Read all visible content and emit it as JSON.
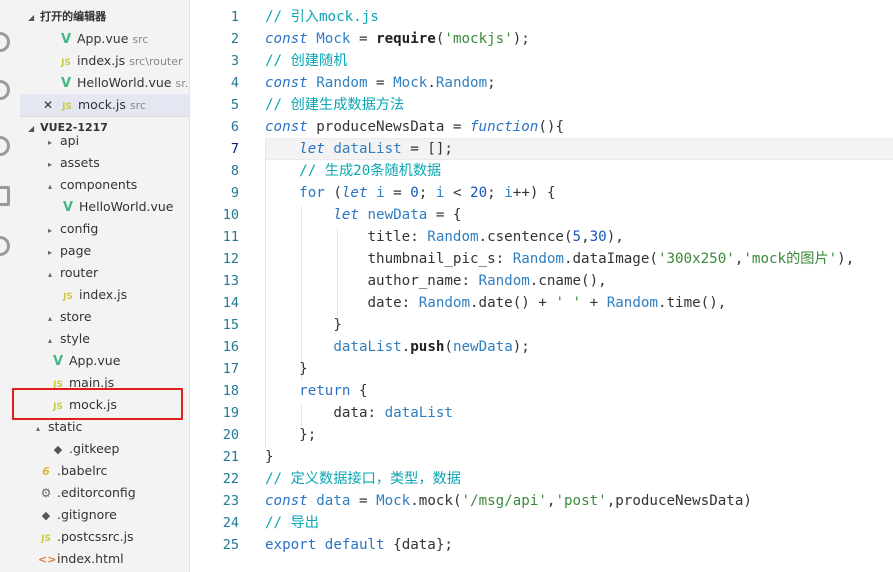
{
  "sidebar": {
    "open_editors_header": "打开的编辑器",
    "open_editors": [
      {
        "icon": "vue",
        "name": "App.vue",
        "desc": "src",
        "active": false,
        "close": false
      },
      {
        "icon": "js",
        "name": "index.js",
        "desc": "src\\router",
        "active": false,
        "close": false
      },
      {
        "icon": "vue",
        "name": "HelloWorld.vue",
        "desc": "sr...",
        "active": false,
        "close": false
      },
      {
        "icon": "js",
        "name": "mock.js",
        "desc": "src",
        "active": true,
        "close": true
      }
    ],
    "project_header": "VUE2-1217",
    "tree": [
      {
        "depth": 2,
        "arrow": "▸",
        "icon": "",
        "name": "api"
      },
      {
        "depth": 2,
        "arrow": "▸",
        "icon": "",
        "name": "assets"
      },
      {
        "depth": 2,
        "arrow": "▴",
        "icon": "",
        "name": "components"
      },
      {
        "depth": 3,
        "arrow": "",
        "icon": "vue",
        "name": "HelloWorld.vue"
      },
      {
        "depth": 2,
        "arrow": "▸",
        "icon": "",
        "name": "config"
      },
      {
        "depth": 2,
        "arrow": "▸",
        "icon": "",
        "name": "page"
      },
      {
        "depth": 2,
        "arrow": "▴",
        "icon": "",
        "name": "router"
      },
      {
        "depth": 3,
        "arrow": "",
        "icon": "js",
        "name": "index.js"
      },
      {
        "depth": 2,
        "arrow": "▴",
        "icon": "",
        "name": "store"
      },
      {
        "depth": 2,
        "arrow": "▴",
        "icon": "",
        "name": "style"
      },
      {
        "depth": 2,
        "arrow": "",
        "icon": "vue",
        "name": "App.vue"
      },
      {
        "depth": 2,
        "arrow": "",
        "icon": "js",
        "name": "main.js"
      },
      {
        "depth": 2,
        "arrow": "",
        "icon": "js",
        "name": "mock.js"
      },
      {
        "depth": 1,
        "arrow": "▴",
        "icon": "",
        "name": "static"
      },
      {
        "depth": 2,
        "arrow": "",
        "icon": "git",
        "name": ".gitkeep"
      },
      {
        "depth": 1,
        "arrow": "",
        "icon": "babel",
        "name": ".babelrc"
      },
      {
        "depth": 1,
        "arrow": "",
        "icon": "gear",
        "name": ".editorconfig"
      },
      {
        "depth": 1,
        "arrow": "",
        "icon": "git",
        "name": ".gitignore"
      },
      {
        "depth": 1,
        "arrow": "",
        "icon": "js",
        "name": ".postcssrc.js"
      },
      {
        "depth": 1,
        "arrow": "",
        "icon": "html",
        "name": "index.html"
      }
    ]
  },
  "icon_glyphs": {
    "vue": "V",
    "js": "JS",
    "babel": "6",
    "gear": "⚙",
    "git": "◆",
    "html": "<>",
    "close": "✕"
  },
  "editor": {
    "current_line": 7,
    "lines": [
      [
        [
          "cm",
          "// 引入mock.js"
        ]
      ],
      [
        [
          "kw",
          "const"
        ],
        [
          "id",
          " "
        ],
        [
          "var",
          "Mock"
        ],
        [
          "op",
          " = "
        ],
        [
          "fn",
          "require"
        ],
        [
          "op",
          "("
        ],
        [
          "str",
          "'mockjs'"
        ],
        [
          "op",
          ");"
        ]
      ],
      [
        [
          "cm",
          "// 创建随机"
        ]
      ],
      [
        [
          "kw",
          "const"
        ],
        [
          "id",
          " "
        ],
        [
          "var",
          "Random"
        ],
        [
          "op",
          " = "
        ],
        [
          "var",
          "Mock"
        ],
        [
          "op",
          "."
        ],
        [
          "var",
          "Random"
        ],
        [
          "op",
          ";"
        ]
      ],
      [
        [
          "cm",
          "// 创建生成数据方法"
        ]
      ],
      [
        [
          "kw",
          "const"
        ],
        [
          "id",
          " produceNewsData"
        ],
        [
          "op",
          " = "
        ],
        [
          "kw",
          "function"
        ],
        [
          "op",
          "(){"
        ]
      ],
      [
        [
          "id",
          "    "
        ],
        [
          "kw",
          "let"
        ],
        [
          "id",
          " "
        ],
        [
          "var",
          "dataList"
        ],
        [
          "op",
          " = [];"
        ]
      ],
      [
        [
          "id",
          "    "
        ],
        [
          "cm",
          "// 生成20条随机数据"
        ]
      ],
      [
        [
          "id",
          "    "
        ],
        [
          "kwn",
          "for"
        ],
        [
          "op",
          " ("
        ],
        [
          "kw",
          "let"
        ],
        [
          "id",
          " "
        ],
        [
          "var",
          "i"
        ],
        [
          "op",
          " = "
        ],
        [
          "num",
          "0"
        ],
        [
          "op",
          "; "
        ],
        [
          "var",
          "i"
        ],
        [
          "op",
          " < "
        ],
        [
          "num",
          "20"
        ],
        [
          "op",
          "; "
        ],
        [
          "var",
          "i"
        ],
        [
          "op",
          "++) {"
        ]
      ],
      [
        [
          "id",
          "        "
        ],
        [
          "kw",
          "let"
        ],
        [
          "id",
          " "
        ],
        [
          "var",
          "newData"
        ],
        [
          "op",
          " = {"
        ]
      ],
      [
        [
          "id",
          "            title: "
        ],
        [
          "var",
          "Random"
        ],
        [
          "op",
          "."
        ],
        [
          "id",
          "csentence("
        ],
        [
          "num",
          "5"
        ],
        [
          "op",
          ","
        ],
        [
          "num",
          "30"
        ],
        [
          "op",
          "),"
        ]
      ],
      [
        [
          "id",
          "            thumbnail_pic_s: "
        ],
        [
          "var",
          "Random"
        ],
        [
          "op",
          "."
        ],
        [
          "id",
          "dataImage("
        ],
        [
          "str",
          "'300x250'"
        ],
        [
          "op",
          ","
        ],
        [
          "str",
          "'mock的图片'"
        ],
        [
          "op",
          "),"
        ]
      ],
      [
        [
          "id",
          "            author_name: "
        ],
        [
          "var",
          "Random"
        ],
        [
          "op",
          "."
        ],
        [
          "id",
          "cname(),"
        ]
      ],
      [
        [
          "id",
          "            date: "
        ],
        [
          "var",
          "Random"
        ],
        [
          "op",
          "."
        ],
        [
          "id",
          "date() "
        ],
        [
          "op",
          "+"
        ],
        [
          "id",
          " "
        ],
        [
          "str",
          "' '"
        ],
        [
          "id",
          " "
        ],
        [
          "op",
          "+"
        ],
        [
          "id",
          " "
        ],
        [
          "var",
          "Random"
        ],
        [
          "op",
          "."
        ],
        [
          "id",
          "time(),"
        ]
      ],
      [
        [
          "id",
          "        }"
        ]
      ],
      [
        [
          "id",
          "        "
        ],
        [
          "var",
          "dataList"
        ],
        [
          "op",
          "."
        ],
        [
          "fn",
          "push"
        ],
        [
          "op",
          "("
        ],
        [
          "var",
          "newData"
        ],
        [
          "op",
          ");"
        ]
      ],
      [
        [
          "id",
          "    }"
        ]
      ],
      [
        [
          "id",
          "    "
        ],
        [
          "kwn",
          "return"
        ],
        [
          "op",
          " {"
        ]
      ],
      [
        [
          "id",
          "        data: "
        ],
        [
          "var",
          "dataList"
        ]
      ],
      [
        [
          "id",
          "    };"
        ]
      ],
      [
        [
          "id",
          "}"
        ]
      ],
      [
        [
          "cm",
          "// 定义数据接口，类型，数据"
        ]
      ],
      [
        [
          "kw",
          "const"
        ],
        [
          "id",
          " "
        ],
        [
          "var",
          "data"
        ],
        [
          "op",
          " = "
        ],
        [
          "var",
          "Mock"
        ],
        [
          "op",
          "."
        ],
        [
          "id",
          "mock("
        ],
        [
          "str",
          "'/msg/api'"
        ],
        [
          "op",
          ","
        ],
        [
          "str",
          "'post'"
        ],
        [
          "op",
          ","
        ],
        [
          "id",
          "produceNewsData)"
        ]
      ],
      [
        [
          "cm",
          "// 导出"
        ]
      ],
      [
        [
          "kwn",
          "export"
        ],
        [
          "id",
          " "
        ],
        [
          "kwn",
          "default"
        ],
        [
          "op",
          " {"
        ],
        [
          "id",
          "data"
        ],
        [
          "op",
          "};"
        ]
      ]
    ]
  }
}
